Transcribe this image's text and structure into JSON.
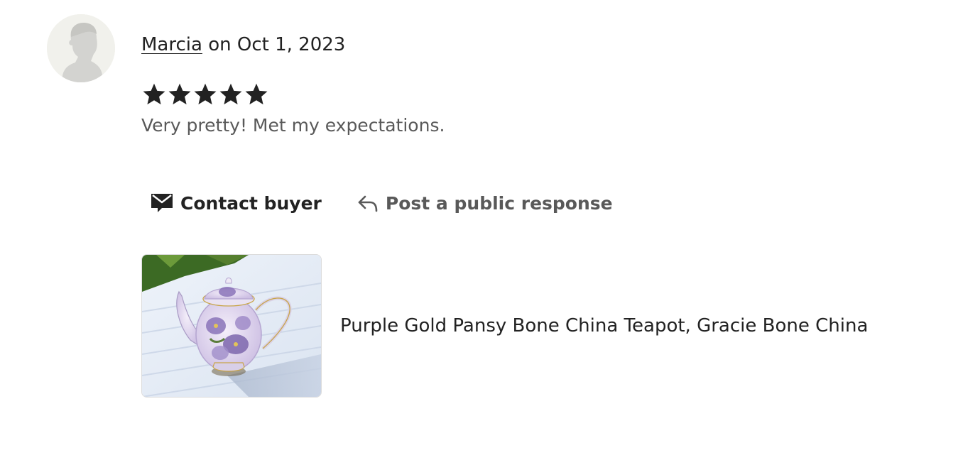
{
  "review": {
    "reviewer_name": "Marcia",
    "date_prefix": " on ",
    "date": "Oct 1, 2023",
    "rating": 5,
    "rating_max": 5,
    "text": "Very pretty! Met my expectations."
  },
  "actions": {
    "contact_label": "Contact buyer",
    "contact_icon": "envelope-icon",
    "respond_label": "Post a public response",
    "respond_icon": "reply-arrow-icon"
  },
  "listing": {
    "title": "Purple Gold Pansy Bone China Teapot, Gracie Bone China"
  },
  "colors": {
    "text_primary": "#222222",
    "text_secondary": "#595959",
    "star": "#222222",
    "avatar_bg": "#f1f1ec",
    "avatar_silhouette": "#d3d3d0"
  }
}
